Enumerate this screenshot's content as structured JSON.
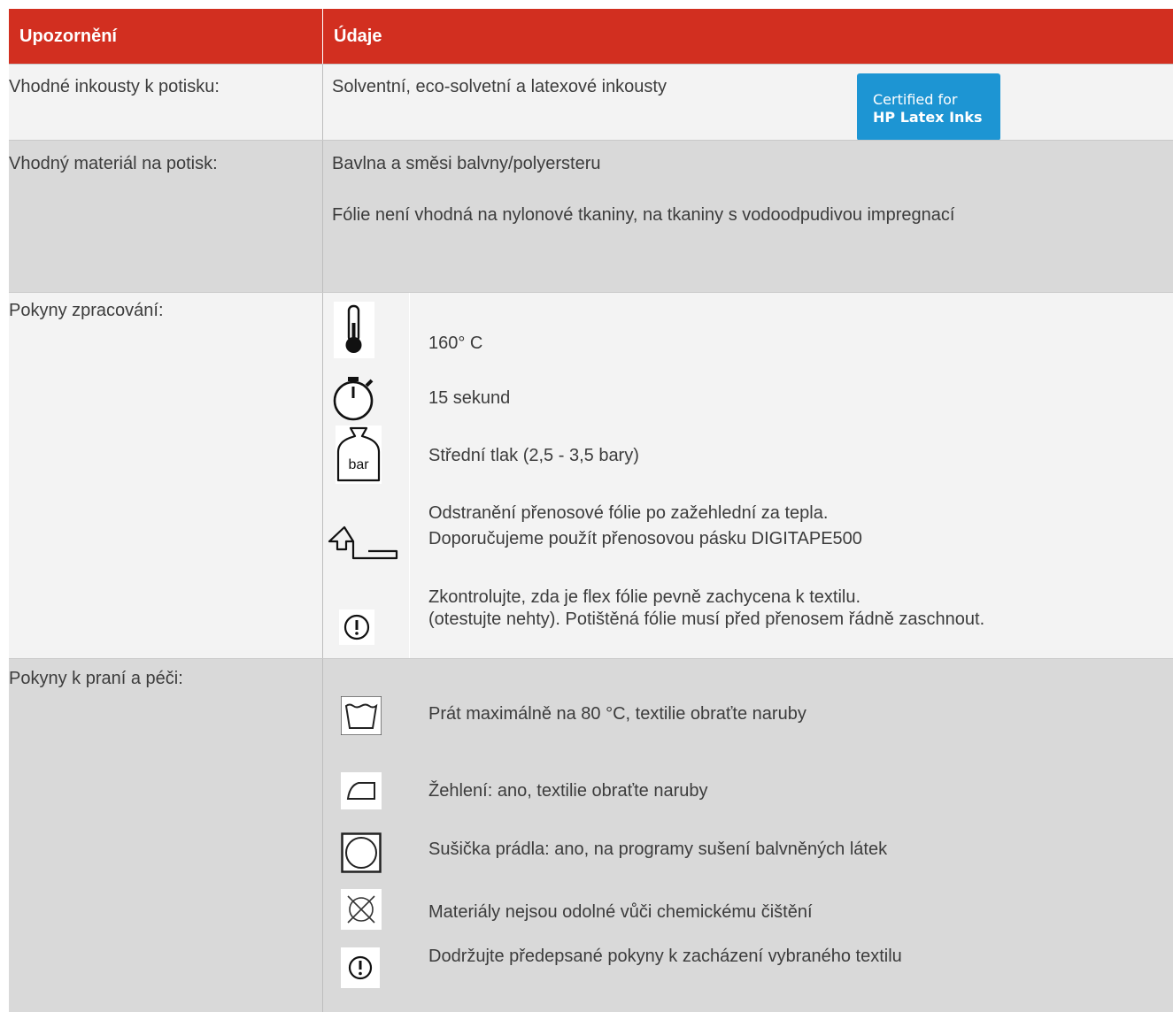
{
  "header": {
    "col1": "Upozornění",
    "col2": "Údaje"
  },
  "rows": {
    "inks": {
      "label": "Vhodné inkousty k potisku:",
      "value": "Solventní, eco-solvetní a latexové inkousty",
      "badge_line1": "Certified for",
      "badge_line2": "HP Latex Inks"
    },
    "material": {
      "label": "Vhodný materiál na potisk:",
      "value1": "Bavlna a směsi balvny/polyersteru",
      "value2": "Fólie není vhodná na nylonové tkaniny, na tkaniny s vodoodpudivou impregnací"
    },
    "processing": {
      "label": "Pokyny zpracování:",
      "items": [
        {
          "icon": "thermometer-icon",
          "text": "160° C"
        },
        {
          "icon": "stopwatch-icon",
          "text": "15 sekund"
        },
        {
          "icon": "weight-bar-icon",
          "icon_text": "bar",
          "text": "Střední tlak (2,5 - 3,5 bary)"
        },
        {
          "icon": "peel-arrow-icon",
          "text": "Odstranění přenosové fólie po zažehlední za tepla.",
          "text2": "Doporučujeme použít přenosovou pásku DIGITAPE500"
        },
        {
          "icon": "exclamation-circle-icon",
          "text": "Zkontrolujte, zda je flex fólie pevně zachycena k textilu.",
          "text2": "(otestujte nehty). Potištěná fólie musí před přenosem řádně zaschnout."
        }
      ]
    },
    "care": {
      "label": "Pokyny k praní a péči:",
      "items": [
        {
          "icon": "wash-tub-icon",
          "text": "Prát maximálně na 80 °C, textilie obraťte naruby"
        },
        {
          "icon": "iron-icon",
          "text": "Žehlení: ano, textilie obraťte naruby"
        },
        {
          "icon": "tumble-dry-icon",
          "text": "Sušička prádla: ano, na programy sušení balvněných látek"
        },
        {
          "icon": "no-dry-clean-icon",
          "text": "Materiály nejsou odolné vůči chemickému čištění"
        },
        {
          "icon": "exclamation-circle-icon",
          "text": "Dodržujte předepsané pokyny k zacházení vybraného textilu"
        }
      ]
    }
  },
  "colors": {
    "header_bg": "#d22f20",
    "row_light": "#f3f3f3",
    "row_dark": "#d9d9d9",
    "badge_bg": "#1d95d3",
    "text": "#3c3c3c"
  }
}
